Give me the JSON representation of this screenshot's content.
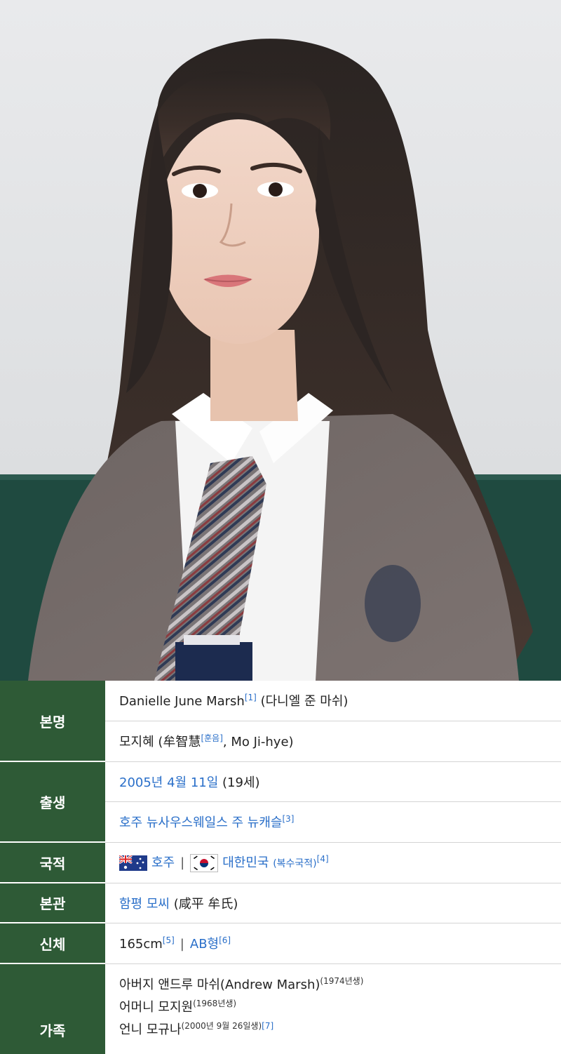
{
  "infobox": {
    "real_name": {
      "header": "본명",
      "line1": {
        "text": "Danielle June Marsh",
        "ref": "[1]",
        "suffix": " (다니엘 준 마쉬)"
      },
      "line2": {
        "prefix": "모지혜 (牟智慧",
        "ref": "[훈음]",
        "suffix": ", Mo Ji-hye)"
      }
    },
    "birth": {
      "header": "출생",
      "date_link": "2005년 4월 11일",
      "age": " (19세)",
      "place_link": "호주 뉴사우스웨일스 주 뉴캐슬",
      "place_ref": "[3]"
    },
    "nationality": {
      "header": "국적",
      "country1": "호주",
      "separator": "|",
      "country2": "대한민국",
      "note": "(복수국적)",
      "ref": "[4]"
    },
    "clan": {
      "header": "본관",
      "link": "함평 모씨",
      "hanja": " (咸平 牟氏)"
    },
    "body": {
      "header": "신체",
      "height": "165cm",
      "height_ref": "[5]",
      "separator": "|",
      "blood_link": "AB형",
      "blood_ref": "[6]"
    },
    "family": {
      "header": "가족",
      "father": {
        "text": "아버지 앤드루 마쉬(Andrew Marsh)",
        "note": "(1974년생)"
      },
      "mother": {
        "text": "어머니 모지원",
        "note": "(1968년생)"
      },
      "sister": {
        "text": "언니 모규나",
        "note": "(2000년 9월 26일생)",
        "ref": "[7]"
      }
    }
  }
}
